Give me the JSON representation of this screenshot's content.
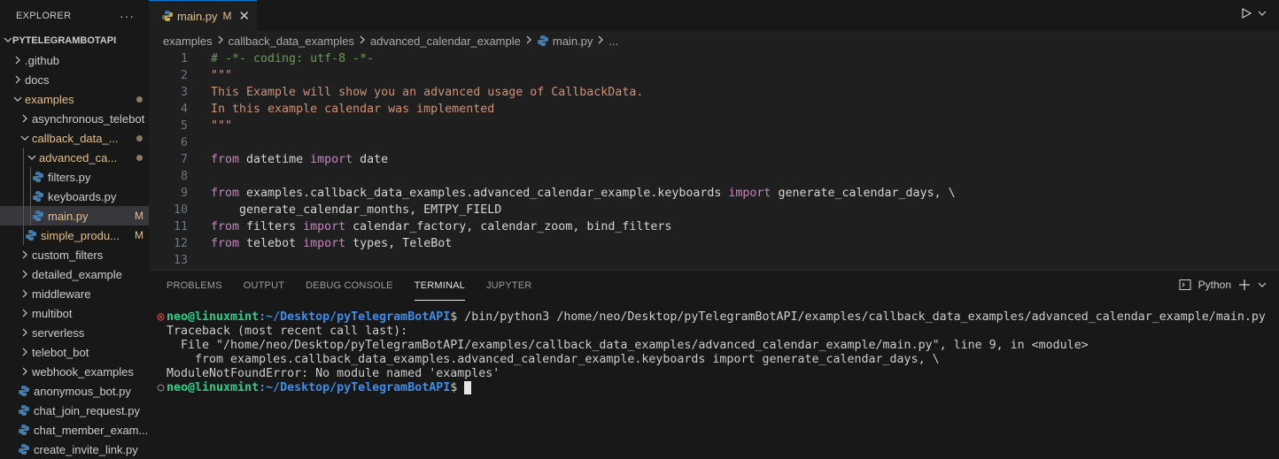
{
  "explorer": {
    "title": "EXPLORER",
    "more": "···",
    "root": "PYTELEGRAMBOTAPI",
    "items": [
      {
        "label": ".github",
        "indent": 1,
        "kind": "folder-closed"
      },
      {
        "label": "docs",
        "indent": 1,
        "kind": "folder-closed"
      },
      {
        "label": "examples",
        "indent": 1,
        "kind": "folder-open",
        "modified_dot": true
      },
      {
        "label": "asynchronous_telebot",
        "indent": 2,
        "kind": "folder-closed"
      },
      {
        "label": "callback_data_...",
        "indent": 2,
        "kind": "folder-open",
        "modified_dot": true
      },
      {
        "label": "advanced_ca...",
        "indent": 3,
        "kind": "folder-open",
        "modified_dot": true
      },
      {
        "label": "filters.py",
        "indent": 4,
        "kind": "python"
      },
      {
        "label": "keyboards.py",
        "indent": 4,
        "kind": "python"
      },
      {
        "label": "main.py",
        "indent": 4,
        "kind": "python",
        "badge": "M",
        "selected": true
      },
      {
        "label": "simple_produ...",
        "indent": 3,
        "kind": "python",
        "badge": "M"
      },
      {
        "label": "custom_filters",
        "indent": 2,
        "kind": "folder-closed"
      },
      {
        "label": "detailed_example",
        "indent": 2,
        "kind": "folder-closed"
      },
      {
        "label": "middleware",
        "indent": 2,
        "kind": "folder-closed"
      },
      {
        "label": "multibot",
        "indent": 2,
        "kind": "folder-closed"
      },
      {
        "label": "serverless",
        "indent": 2,
        "kind": "folder-closed"
      },
      {
        "label": "telebot_bot",
        "indent": 2,
        "kind": "folder-closed"
      },
      {
        "label": "webhook_examples",
        "indent": 2,
        "kind": "folder-closed"
      },
      {
        "label": "anonymous_bot.py",
        "indent": 2,
        "kind": "python"
      },
      {
        "label": "chat_join_request.py",
        "indent": 2,
        "kind": "python"
      },
      {
        "label": "chat_member_exam...",
        "indent": 2,
        "kind": "python"
      },
      {
        "label": "create_invite_link.py",
        "indent": 2,
        "kind": "python"
      }
    ]
  },
  "editor": {
    "tab": {
      "label": "main.py",
      "status": "M",
      "close": "✕"
    },
    "breadcrumb": [
      "examples",
      "callback_data_examples",
      "advanced_calendar_example",
      "main.py",
      "..."
    ],
    "lines": [
      {
        "n": "1",
        "tokens": [
          [
            "c-com",
            "# -*- coding: utf-8 -*-"
          ]
        ]
      },
      {
        "n": "2",
        "tokens": [
          [
            "c-str",
            "\"\"\""
          ]
        ]
      },
      {
        "n": "3",
        "tokens": [
          [
            "c-str",
            "This Example will show you an advanced usage of CallbackData."
          ]
        ]
      },
      {
        "n": "4",
        "tokens": [
          [
            "c-str",
            "In this example calendar was implemented"
          ]
        ]
      },
      {
        "n": "5",
        "tokens": [
          [
            "c-str",
            "\"\"\""
          ]
        ]
      },
      {
        "n": "6",
        "tokens": []
      },
      {
        "n": "7",
        "tokens": [
          [
            "c-kw",
            "from"
          ],
          [
            "c-def",
            " datetime "
          ],
          [
            "c-kw",
            "import"
          ],
          [
            "c-def",
            " date"
          ]
        ]
      },
      {
        "n": "8",
        "tokens": []
      },
      {
        "n": "9",
        "tokens": [
          [
            "c-kw",
            "from"
          ],
          [
            "c-def",
            " examples.callback_data_examples.advanced_calendar_example.keyboards "
          ],
          [
            "c-kw",
            "import"
          ],
          [
            "c-def",
            " generate_calendar_days, \\"
          ]
        ]
      },
      {
        "n": "10",
        "tokens": [
          [
            "c-def",
            "    generate_calendar_months, EMTPY_FIELD"
          ]
        ]
      },
      {
        "n": "11",
        "tokens": [
          [
            "c-kw",
            "from"
          ],
          [
            "c-def",
            " filters "
          ],
          [
            "c-kw",
            "import"
          ],
          [
            "c-def",
            " calendar_factory, calendar_zoom, bind_filters"
          ]
        ]
      },
      {
        "n": "12",
        "tokens": [
          [
            "c-kw",
            "from"
          ],
          [
            "c-def",
            " telebot "
          ],
          [
            "c-kw",
            "import"
          ],
          [
            "c-def",
            " types, TeleBot"
          ]
        ]
      },
      {
        "n": "13",
        "tokens": []
      }
    ]
  },
  "panel": {
    "tabs": [
      "PROBLEMS",
      "OUTPUT",
      "DEBUG CONSOLE",
      "TERMINAL",
      "JUPYTER"
    ],
    "active_tab": "TERMINAL",
    "shell_label": "Python",
    "terminal": {
      "prompt_user": "neo@linuxmint",
      "prompt_path": ":~/Desktop/pyTelegramBotAPI",
      "command": "$ /bin/python3 /home/neo/Desktop/pyTelegramBotAPI/examples/callback_data_examples/advanced_calendar_example/main.py",
      "output": [
        "Traceback (most recent call last):",
        "  File \"/home/neo/Desktop/pyTelegramBotAPI/examples/callback_data_examples/advanced_calendar_example/main.py\", line 9, in <module>",
        "    from examples.callback_data_examples.advanced_calendar_example.keyboards import generate_calendar_days, \\",
        "ModuleNotFoundError: No module named 'examples'"
      ],
      "prompt2_user": "neo@linuxmint",
      "prompt2_path": ":~/Desktop/pyTelegramBotAPI",
      "prompt2_suffix": "$ "
    }
  },
  "colors": {
    "accent": "#0078d4",
    "modified": "#e2c08d",
    "error": "#f14c4c"
  }
}
